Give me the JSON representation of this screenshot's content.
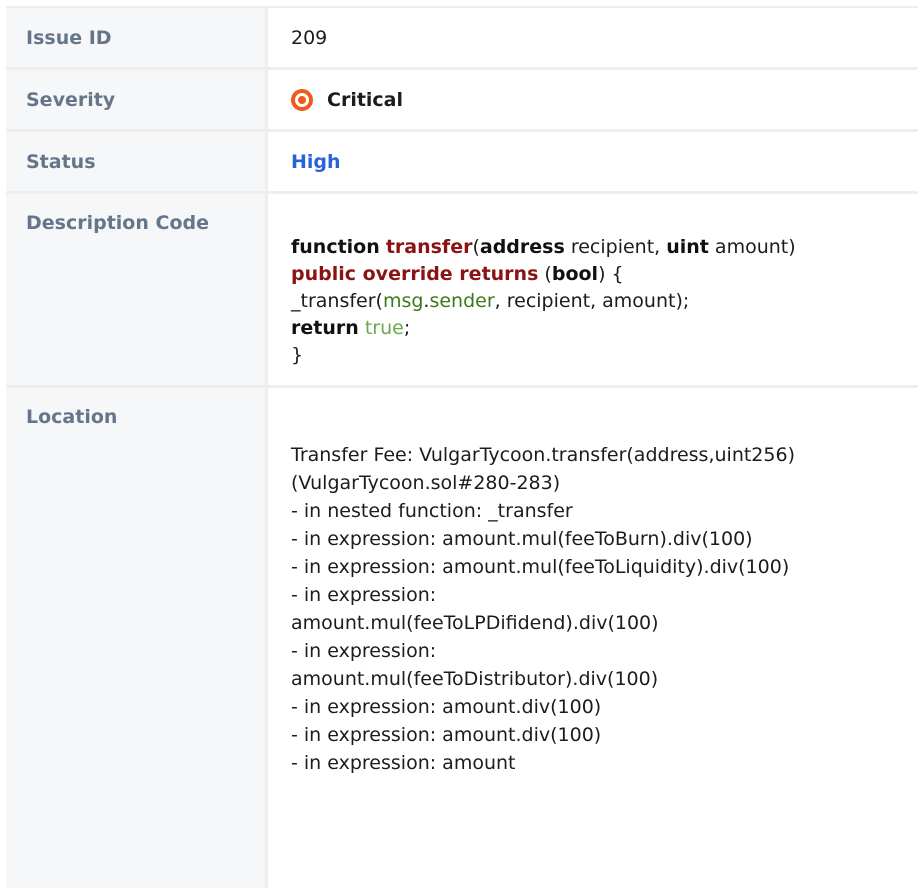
{
  "rows": {
    "issue_id": {
      "label": "Issue ID",
      "value": "209"
    },
    "severity": {
      "label": "Severity",
      "value": "Critical",
      "icon": "severity-critical-icon",
      "icon_color": "#f05a1a"
    },
    "status": {
      "label": "Status",
      "value": "High",
      "color": "#2864d8"
    },
    "description": {
      "label": "Description Code",
      "code": {
        "l1_kw1": "function",
        "l1_name": "transfer",
        "l1_p1": "(",
        "l1_kw2": "address",
        "l1_p2": " recipient, ",
        "l1_kw3": "uint",
        "l1_p3": " amount)",
        "l2_mod": "public override returns",
        "l2_p1": " (",
        "l2_kw": "bool",
        "l2_p2": ") {",
        "l3_p1": "_transfer(",
        "l3_msg": "msg",
        "l3_dot": ".",
        "l3_sender": "sender",
        "l3_p2": ", recipient, amount);",
        "l4_kw": "return",
        "l4_sp": " ",
        "l4_lit": "true",
        "l4_p": ";",
        "l5": "}"
      }
    },
    "location": {
      "label": "Location",
      "lines": [
        "Transfer Fee: VulgarTycoon.transfer(address,uint256)",
        "(VulgarTycoon.sol#280-283)",
        "- in nested function: _transfer",
        "- in expression: amount.mul(feeToBurn).div(100)",
        "- in expression: amount.mul(feeToLiquidity).div(100)",
        "- in expression:",
        "amount.mul(feeToLPDifidend).div(100)",
        "- in expression:",
        "amount.mul(feeToDistributor).div(100)",
        "- in expression: amount.div(100)",
        "- in expression: amount.div(100)",
        "- in expression: amount"
      ]
    }
  }
}
